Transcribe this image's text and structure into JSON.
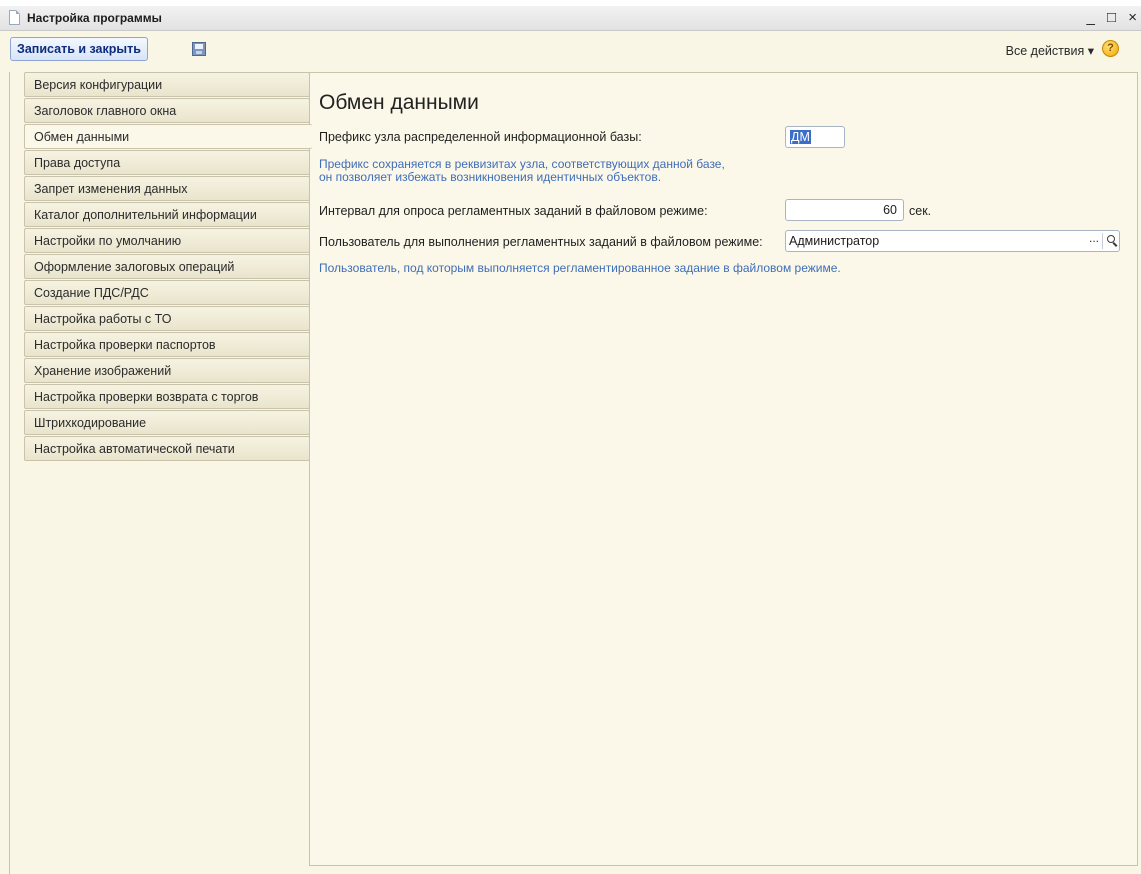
{
  "window": {
    "title": "Настройка программы",
    "controls": "_ □ ×"
  },
  "toolbar": {
    "save_close_label": "Записать и закрыть",
    "save_icon": "floppy-disk-icon",
    "all_actions_label": "Все действия ▾",
    "help_icon": "help-icon",
    "help_glyph": "?"
  },
  "tabs": [
    {
      "label": "Версия конфигурации"
    },
    {
      "label": "Заголовок главного окна"
    },
    {
      "label": "Обмен данными",
      "active": true
    },
    {
      "label": "Права доступа"
    },
    {
      "label": "Запрет изменения данных"
    },
    {
      "label": "Каталог дополнительний информации"
    },
    {
      "label": "Настройки по умолчанию"
    },
    {
      "label": "Оформление залоговых операций"
    },
    {
      "label": "Создание ПДС/РДС"
    },
    {
      "label": "Настройка работы с ТО"
    },
    {
      "label": "Настройка проверки паспортов"
    },
    {
      "label": "Хранение изображений"
    },
    {
      "label": "Настройка проверки возврата с торгов"
    },
    {
      "label": "Штрихкодирование"
    },
    {
      "label": "Настройка автоматической печати"
    }
  ],
  "panel": {
    "title": "Обмен данными",
    "prefix_label": "Префикс узла распределенной информационной базы:",
    "prefix_value": "ДМ",
    "prefix_hint_line1": "Префикс сохраняется в реквизитах узла, соответствующих данной базе,",
    "prefix_hint_line2": "он позволяет избежать возникновения идентичных объектов.",
    "interval_label": "Интервал для опроса регламентных заданий в файловом режиме:",
    "interval_value": "60",
    "interval_unit": "сек.",
    "user_label": "Пользователь для выполнения регламентных заданий в файловом режиме:",
    "user_value": "Администратор",
    "user_dots": "...",
    "user_hint": "Пользователь, под которым выполняется регламентированное задание в файловом режиме."
  },
  "colors": {
    "window_bg": "#f9f6e6",
    "hint_text": "#3f6db7",
    "selection": "#3a6ec8"
  }
}
